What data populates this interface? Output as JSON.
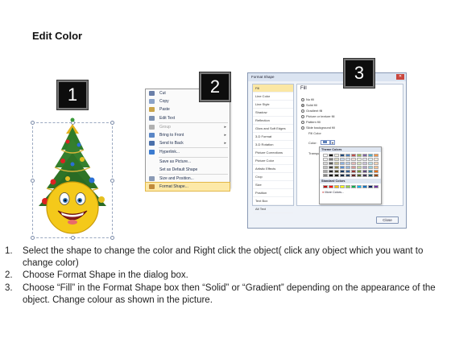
{
  "title": "Edit Color",
  "badges": [
    "1",
    "2",
    "3"
  ],
  "context_menu": {
    "items": [
      {
        "label": "Cut",
        "icon": "scissors-icon",
        "dim": false,
        "arrow": false
      },
      {
        "label": "Copy",
        "icon": "copy-icon",
        "dim": false,
        "arrow": false
      },
      {
        "label": "Paste",
        "icon": "paste-icon",
        "dim": false,
        "arrow": false
      },
      {
        "label": "Edit Text",
        "icon": "edit-text-icon",
        "dim": false,
        "arrow": false
      },
      {
        "label": "Group",
        "icon": "group-icon",
        "dim": true,
        "arrow": true
      },
      {
        "label": "Bring to Front",
        "icon": "bring-front-icon",
        "dim": false,
        "arrow": true
      },
      {
        "label": "Send to Back",
        "icon": "send-back-icon",
        "dim": false,
        "arrow": true
      },
      {
        "label": "Hyperlink...",
        "icon": "hyperlink-icon",
        "dim": false,
        "arrow": false
      },
      {
        "label": "Save as Picture...",
        "icon": "",
        "dim": false,
        "arrow": false
      },
      {
        "label": "Set as Default Shape",
        "icon": "",
        "dim": false,
        "arrow": false
      },
      {
        "label": "Size and Position...",
        "icon": "size-icon",
        "dim": false,
        "arrow": false
      },
      {
        "label": "Format Shape...",
        "icon": "format-shape-icon",
        "dim": false,
        "arrow": false,
        "highlight": true
      }
    ]
  },
  "dialog": {
    "title": "Format Shape",
    "close_label": "Close",
    "categories": [
      "Fill",
      "Line Color",
      "Line Style",
      "Shadow",
      "Reflection",
      "Glow and Soft Edges",
      "3-D Format",
      "3-D Rotation",
      "Picture Corrections",
      "Picture Color",
      "Artistic Effects",
      "Crop",
      "Size",
      "Position",
      "Text Box",
      "Alt Text"
    ],
    "selected_category": "Fill",
    "fill_heading": "Fill",
    "options": [
      "No fill",
      "Solid fill",
      "Gradient fill",
      "Picture or texture fill",
      "Pattern fill",
      "Slide background fill"
    ],
    "selected_option": "Solid fill",
    "fill_color_label": "Fill Color",
    "color_label": "Color:",
    "transparency_label": "Transparency:",
    "theme_colors_label": "Theme Colors",
    "standard_colors_label": "Standard Colors",
    "more_colors_label": "More Colors..."
  },
  "palette": {
    "theme_top": [
      "#ffffff",
      "#000000",
      "#eeece1",
      "#1f497d",
      "#4f81bd",
      "#c0504d",
      "#9bbb59",
      "#8064a2",
      "#4bacc6",
      "#f79646"
    ],
    "theme_shades": [
      [
        "#f2f2f2",
        "#7f7f7f",
        "#ddd9c3",
        "#c6d9f0",
        "#dbe5f1",
        "#f2dcdb",
        "#ebf1dd",
        "#e5e0ec",
        "#dbeef3",
        "#fdeada"
      ],
      [
        "#d8d8d8",
        "#595959",
        "#c4bd97",
        "#8db3e2",
        "#b8cce4",
        "#e5b9b7",
        "#d7e3bc",
        "#ccc1d9",
        "#b7dde8",
        "#fbd5b5"
      ],
      [
        "#bfbfbf",
        "#3f3f3f",
        "#938953",
        "#548dd4",
        "#95b3d7",
        "#d99694",
        "#c3d69b",
        "#b2a2c7",
        "#92cddc",
        "#fac08f"
      ],
      [
        "#a5a5a5",
        "#262626",
        "#494429",
        "#17365d",
        "#366092",
        "#953734",
        "#76923c",
        "#5f497a",
        "#31859b",
        "#e36c09"
      ],
      [
        "#7f7f7f",
        "#0c0c0c",
        "#1d1b10",
        "#0f243e",
        "#244061",
        "#632423",
        "#4f6128",
        "#3f3151",
        "#205867",
        "#974806"
      ]
    ],
    "standard": [
      "#c00000",
      "#ff0000",
      "#ffc000",
      "#ffff00",
      "#92d050",
      "#00b050",
      "#00b0f0",
      "#0070c0",
      "#002060",
      "#7030a0"
    ]
  },
  "instructions": [
    {
      "num": "1.",
      "text": "Select the shape to change the color and Right click the object( click any object which you want to change color)"
    },
    {
      "num": "2.",
      "text": "Choose Format Shape in the dialog box."
    },
    {
      "num": "3.",
      "text": "Choose “Fill” in the Format Shape box then “Solid” or “Gradient” depending on the appearance of the object. Change colour as shown in the picture."
    }
  ]
}
